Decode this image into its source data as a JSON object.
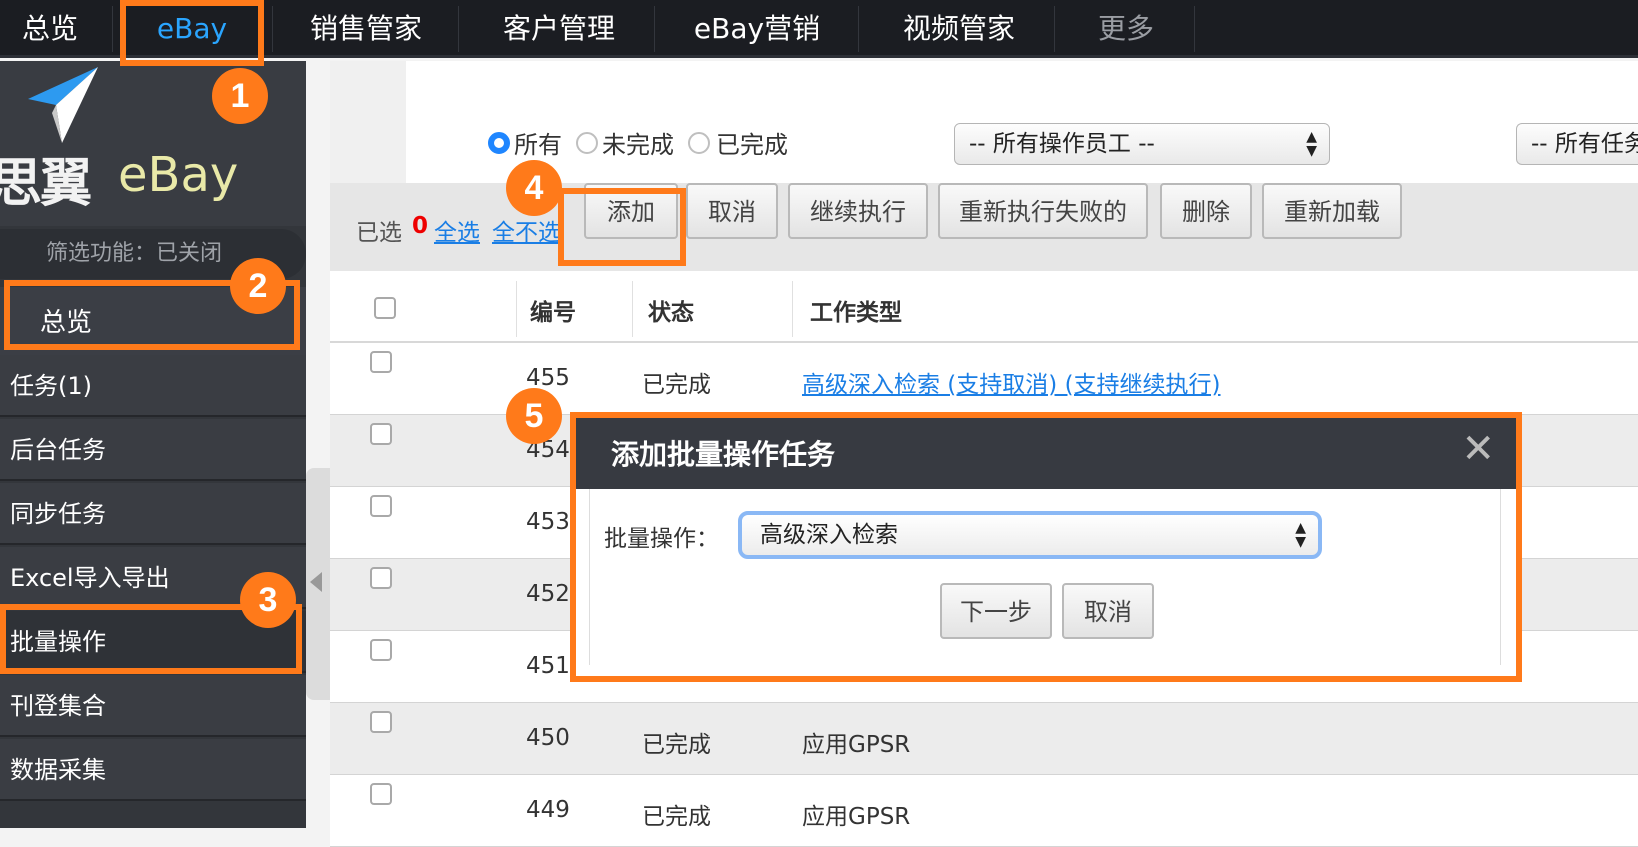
{
  "topnav": {
    "items": [
      {
        "label": "总览"
      },
      {
        "label": "eBay"
      },
      {
        "label": "销售管家"
      },
      {
        "label": "客户管理"
      },
      {
        "label": "eBay营销"
      },
      {
        "label": "视频管家"
      },
      {
        "label": "更多"
      }
    ]
  },
  "sidebar": {
    "logo_cn": "思翼",
    "logo_en": "eBay",
    "filter_status": "筛选功能：已关闭",
    "overview": "总览",
    "items": [
      {
        "label": "任务(1)"
      },
      {
        "label": "后台任务"
      },
      {
        "label": "同步任务"
      },
      {
        "label": "Excel导入导出"
      },
      {
        "label": "批量操作"
      },
      {
        "label": "刊登集合"
      },
      {
        "label": "数据采集"
      }
    ]
  },
  "filters": {
    "radios": [
      {
        "label": "所有",
        "checked": true
      },
      {
        "label": "未完成",
        "checked": false
      },
      {
        "label": "已完成",
        "checked": false
      }
    ],
    "employee_select": "-- 所有操作员工 --",
    "task_select": "-- 所有任务"
  },
  "toolbar": {
    "selected_label": "已选",
    "selected_count": "0",
    "select_all": "全选",
    "select_none": "全不选",
    "buttons": [
      "添加",
      "取消",
      "继续执行",
      "重新执行失败的",
      "删除",
      "重新加载"
    ]
  },
  "table": {
    "headers": [
      "编号",
      "状态",
      "工作类型"
    ],
    "rows": [
      {
        "id": "455",
        "status": "已完成",
        "type": "高级深入检索 (支持取消) (支持继续执行)"
      },
      {
        "id": "454",
        "status": "",
        "type": ""
      },
      {
        "id": "453",
        "status": "",
        "type": ""
      },
      {
        "id": "452",
        "status": "",
        "type": ""
      },
      {
        "id": "451",
        "status": "",
        "type": ""
      },
      {
        "id": "450",
        "status": "已完成",
        "type": "应用GPSR"
      },
      {
        "id": "449",
        "status": "已完成",
        "type": "应用GPSR"
      }
    ]
  },
  "dialog": {
    "title": "添加批量操作任务",
    "close": "✕",
    "field_label": "批量操作：",
    "select_value": "高级深入检索",
    "next_button": "下一步",
    "cancel_button": "取消"
  },
  "annotations": {
    "badges": [
      "1",
      "2",
      "3",
      "4",
      "5"
    ],
    "highlight_color": "#ff7a1a"
  },
  "colors": {
    "nav_bg": "#1b1d22",
    "active_nav": "#2aa5ff",
    "sidebar_bg": "#33363b",
    "link": "#1a7ee5",
    "count_red": "#ee0000"
  }
}
